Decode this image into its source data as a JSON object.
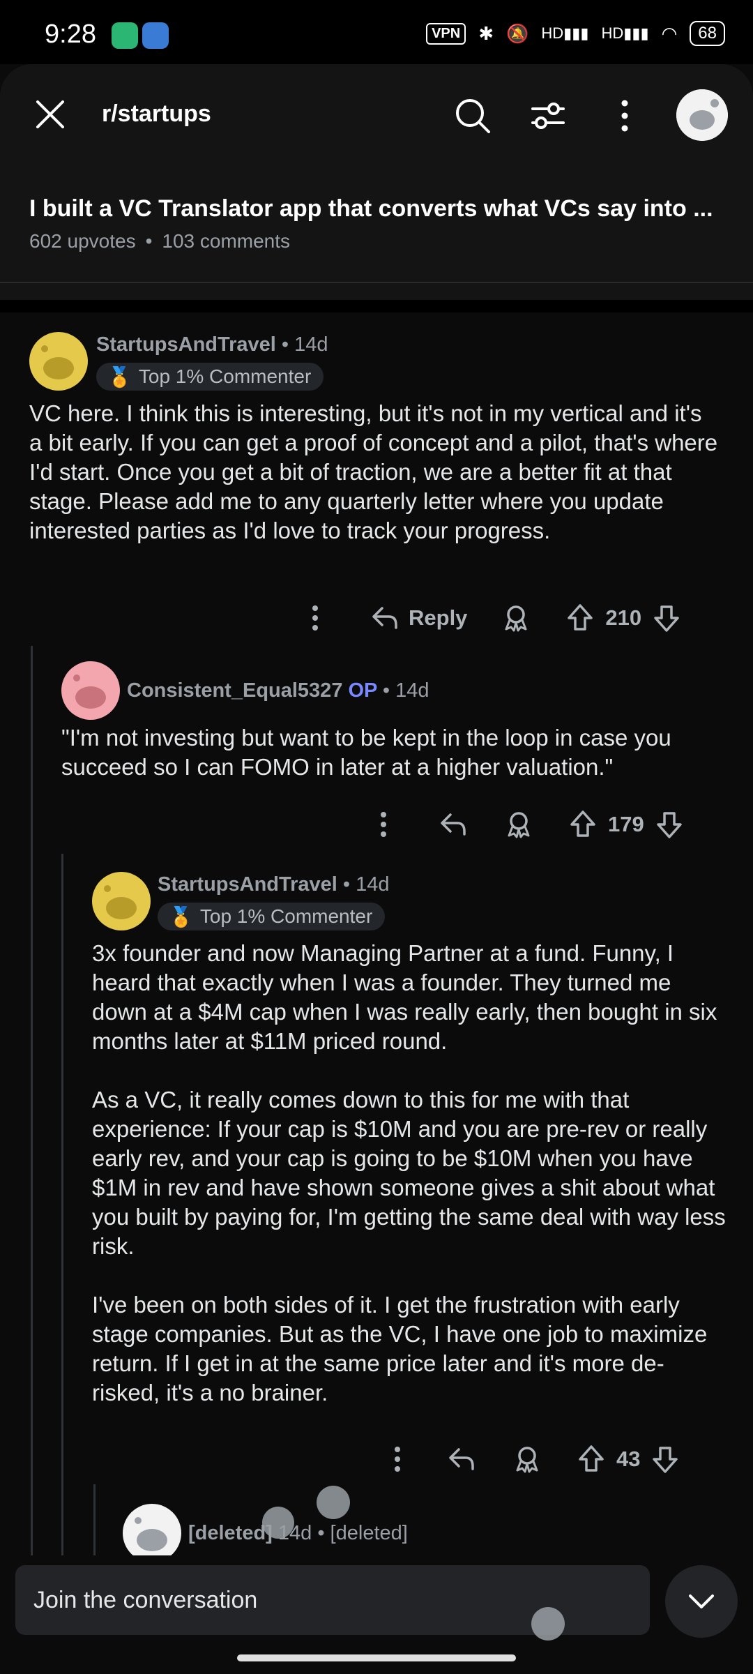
{
  "status_bar": {
    "time": "9:28",
    "battery": "68",
    "vpn_label": "VPN",
    "hd1": "HD",
    "hd2": "HD"
  },
  "header": {
    "subreddit": "r/startups",
    "post_title": "I built a VC Translator app that converts what VCs say into ...",
    "upvotes": "602 upvotes",
    "comments": "103 comments"
  },
  "comments": [
    {
      "user": "StartupsAndTravel",
      "age": "• 14d",
      "badge": "Top 1% Commenter",
      "paragraphs": [
        "VC here. I think this is interesting, but it's not in my vertical and it's a bit early. If you can get a proof of concept and a pilot, that's where I'd start. Once you get a bit of traction, we are a better fit at that stage. Please add me to any quarterly letter where you update interested parties as I'd love to track your progress."
      ],
      "reply_label": "Reply",
      "score": "210"
    },
    {
      "user": "Consistent_Equal5327",
      "op": "OP",
      "age": "• 14d",
      "paragraphs": [
        "\"I'm not investing but want to be kept in the loop in case you succeed so I can FOMO in later at a higher valuation.\""
      ],
      "score": "179"
    },
    {
      "user": "StartupsAndTravel",
      "age": "• 14d",
      "badge": "Top 1% Commenter",
      "paragraphs": [
        "3x founder and now Managing Partner at a fund. Funny, I heard that exactly when I was a founder. They turned me down at a $4M cap when I was really early, then bought in six months later at $11M priced round.",
        "As a VC, it really comes down to this for me with that experience: If your cap is $10M and you are pre-rev or really early rev, and your cap is going to be $10M when you have $1M in rev and have shown someone gives a shit about what you built by paying for, I'm getting the same deal with way less risk.",
        "I've been on both sides of it. I get the frustration with early stage companies. But as the VC, I have one job to maximize return. If I get in at the same price later and it's more de-risked, it's a no brainer."
      ],
      "score": "43"
    },
    {
      "user": "[deleted]",
      "age": "14d • [deleted]"
    }
  ],
  "composer": {
    "placeholder": "Join the conversation"
  },
  "colors": {
    "background": "#0b0b0c",
    "op_label": "#7a88ff",
    "avatar_yellow": "#e5c94a",
    "avatar_pink": "#f3a6ad"
  }
}
